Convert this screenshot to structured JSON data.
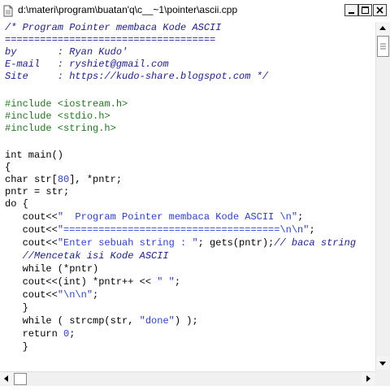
{
  "window": {
    "title": "d:\\materi\\program\\buatan'q\\c__~1\\pointer\\ascii.cpp",
    "icons": {
      "document": "document-icon",
      "minimize": "minimize-icon",
      "maximize": "maximize-icon",
      "close": "close-icon"
    }
  },
  "code": {
    "comment_1": "/* Program Pointer membaca Kode ASCII",
    "comment_2": "====================================",
    "comment_3": "by       : Ryan Kudo'",
    "comment_4": "E-mail   : ryshiet@gmail.com",
    "comment_5": "Site     : https://kudo-share.blogspot.com */",
    "include_1": "#include <iostream.h>",
    "include_2": "#include <stdio.h>",
    "include_3": "#include <string.h>",
    "main_1": "int main()",
    "main_2": "{",
    "decl_a": "char str[",
    "decl_num": "80",
    "decl_b": "], *pntr;",
    "assign": "pntr = str;",
    "do_open": "do {",
    "cout1_a": "   cout<<",
    "cout1_s": "\"  Program Pointer membaca Kode ASCII \\n\"",
    "cout1_b": ";",
    "cout2_a": "   cout<<",
    "cout2_s": "\"=====================================\\n\\n\"",
    "cout2_b": ";",
    "cout3_a": "   cout<<",
    "cout3_s": "\"Enter sebuah string : \"",
    "cout3_b": "; gets(pntr);",
    "cout3_c": "// baca string",
    "comment_cetak": "   //Mencetak isi Kode ASCII",
    "while_pntr": "   while (*pntr)",
    "cout4_a": "   cout<<(int) *pntr++ << ",
    "cout4_s": "\" \"",
    "cout4_b": ";",
    "cout5_a": "   cout<<",
    "cout5_s": "\"\\n\\n\"",
    "cout5_b": ";",
    "brace_close_1": "   }",
    "while_cmp_a": "   while ( strcmp(str, ",
    "while_cmp_s": "\"done\"",
    "while_cmp_b": ") );",
    "return_a": "   return ",
    "return_num": "0",
    "return_b": ";",
    "brace_close_2": "   }"
  },
  "colors": {
    "comment": "#1c1c9c",
    "preprocessor": "#1f7a1f",
    "string": "#2a3ee0",
    "number": "#2a3ee0",
    "text": "#000000"
  },
  "scrollbars": {
    "vertical": {
      "up_icon": "arrow-up-icon",
      "down_icon": "arrow-down-icon",
      "position": 0.0
    },
    "horizontal": {
      "left_icon": "arrow-left-icon",
      "right_icon": "arrow-right-icon",
      "position": 0.0
    }
  }
}
